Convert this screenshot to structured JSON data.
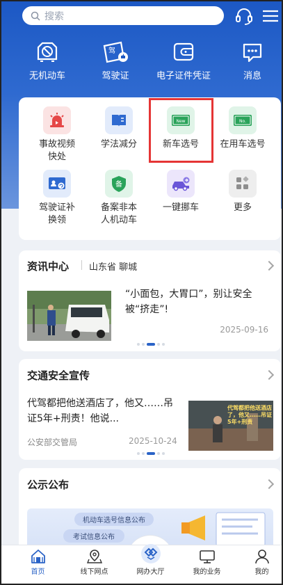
{
  "header": {
    "search_placeholder": "搜索",
    "icons": [
      "search-icon",
      "headset-icon",
      "menu-icon"
    ]
  },
  "quick_actions": [
    {
      "label": "无机动车",
      "icon": "no-vehicle-icon"
    },
    {
      "label": "驾驶证",
      "icon": "license-icon"
    },
    {
      "label": "电子证件凭证",
      "icon": "wallet-icon"
    },
    {
      "label": "消息",
      "icon": "message-icon"
    }
  ],
  "services": [
    {
      "label_1": "事故视频",
      "label_2": "快处",
      "icon": "siren-icon",
      "color": "#fbe3e3"
    },
    {
      "label_1": "学法减分",
      "label_2": "",
      "icon": "book-icon",
      "color": "#e2ebfb"
    },
    {
      "label_1": "新车选号",
      "label_2": "",
      "icon": "new-plate-icon",
      "color": "#e0f4e8"
    },
    {
      "label_1": "在用车选号",
      "label_2": "",
      "icon": "plate-icon",
      "color": "#e0f4e8"
    },
    {
      "label_1": "驾驶证补",
      "label_2": "换领",
      "icon": "license-card-icon",
      "color": "#e2ebfb"
    },
    {
      "label_1": "备案非本",
      "label_2": "人机动车",
      "icon": "shield-icon",
      "color": "#e0f4e8"
    },
    {
      "label_1": "一键挪车",
      "label_2": "",
      "icon": "move-car-icon",
      "color": "#ece6fb"
    },
    {
      "label_1": "更多",
      "label_2": "",
      "icon": "more-icon",
      "color": "#eeeeee"
    }
  ],
  "news": {
    "title": "资讯中心",
    "region": "山东省 聊城",
    "headline": "“小面包，大胃口”，别让安全被“挤走”!",
    "date": "2025-09-16"
  },
  "safety": {
    "title": "交通安全宣传",
    "headline": "代驾都把他送酒店了，他又……吊证5年+刑责！他说...",
    "source": "公安部交管局",
    "date": "2025-10-24",
    "thumb_caption": "代驾都把他送酒店了，他又……吊证5年+刑责"
  },
  "notice": {
    "title": "公示公布",
    "chip_1": "机动车选号信息公布",
    "chip_2": "考试信息公布"
  },
  "tabbar": [
    {
      "label": "首页",
      "icon": "home-icon",
      "active": true
    },
    {
      "label": "线下网点",
      "icon": "location-icon",
      "active": false
    },
    {
      "label": "网办大厅",
      "icon": "hall-icon",
      "active": false
    },
    {
      "label": "我的业务",
      "icon": "monitor-icon",
      "active": false
    },
    {
      "label": "我的",
      "icon": "user-icon",
      "active": false
    }
  ],
  "colors": {
    "brand": "#2a63c7",
    "highlight": "#e53535"
  }
}
